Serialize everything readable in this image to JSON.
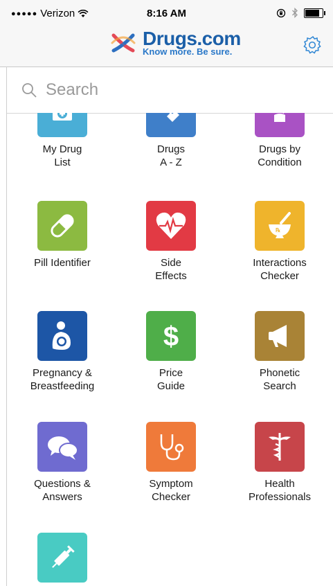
{
  "status_bar": {
    "signal_dots": "●●●●●",
    "carrier": "Verizon",
    "time": "8:16 AM",
    "battery_level": 0.9
  },
  "header": {
    "brand": "Drugs.com",
    "tagline": "Know more. Be sure."
  },
  "search": {
    "placeholder": "Search"
  },
  "tiles": [
    {
      "label": "My Drug\nList",
      "color": "#4aaed6",
      "icon": "medical-folder-icon"
    },
    {
      "label": "Drugs\nA - Z",
      "color": "#3f7fc9",
      "icon": "tag-icon"
    },
    {
      "label": "Drugs by\nCondition",
      "color": "#a952c4",
      "icon": "body-icon"
    },
    {
      "label": "Pill Identifier",
      "color": "#8cba41",
      "icon": "pill-icon"
    },
    {
      "label": "Side\nEffects",
      "color": "#e23a44",
      "icon": "heart-pulse-icon"
    },
    {
      "label": "Interactions\nChecker",
      "color": "#efb42c",
      "icon": "mortar-pestle-icon"
    },
    {
      "label": "Pregnancy &\nBreastfeeding",
      "color": "#1d56a6",
      "icon": "mother-baby-icon"
    },
    {
      "label": "Price\nGuide",
      "color": "#4fae49",
      "icon": "dollar-icon"
    },
    {
      "label": "Phonetic\nSearch",
      "color": "#a98336",
      "icon": "megaphone-icon"
    },
    {
      "label": "Questions &\nAnswers",
      "color": "#6f6bd0",
      "icon": "speech-bubbles-icon"
    },
    {
      "label": "Symptom\nChecker",
      "color": "#ef7a3a",
      "icon": "stethoscope-icon"
    },
    {
      "label": "Health\nProfessionals",
      "color": "#c7454a",
      "icon": "caduceus-icon"
    },
    {
      "label": "",
      "color": "#49cbc3",
      "icon": "syringe-icon"
    }
  ]
}
